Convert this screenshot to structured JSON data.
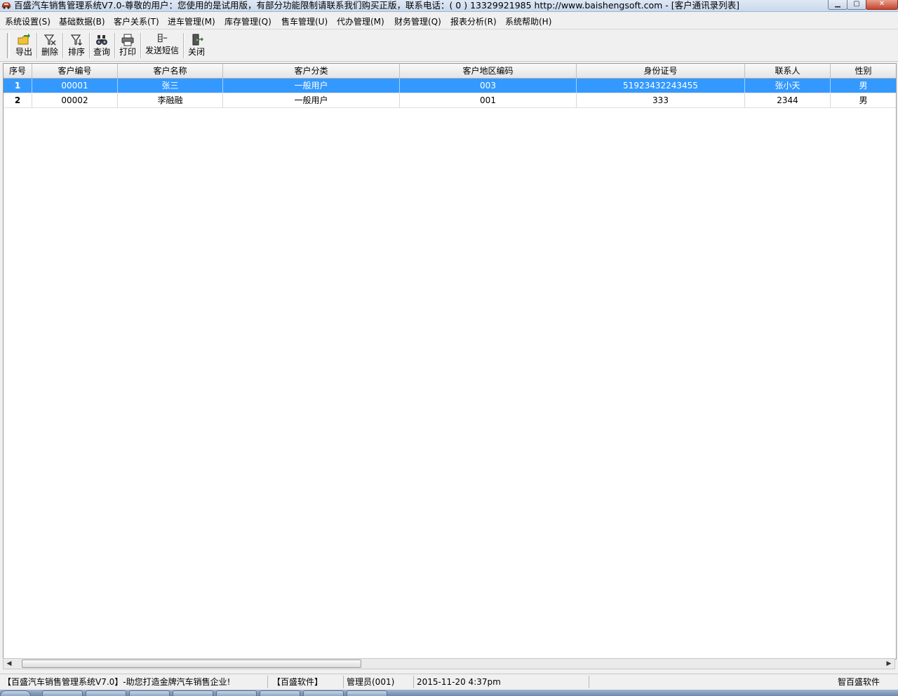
{
  "window": {
    "title": "百盛汽车销售管理系统V7.0-尊敬的用户：您使用的是试用版，有部分功能限制请联系我们购买正版，联系电话：( 0 ) 13329921985  http://www.baishengsoft.com - [客户通讯录列表]",
    "min_glyph": "▁",
    "max_glyph": "▢",
    "close_glyph": "✕"
  },
  "menu": [
    "系统设置(S)",
    "基础数据(B)",
    "客户关系(T)",
    "进车管理(M)",
    "库存管理(Q)",
    "售车管理(U)",
    "代办管理(M)",
    "财务管理(Q)",
    "报表分析(R)",
    "系统帮助(H)"
  ],
  "toolbar": {
    "export": "导出",
    "delete": "删除",
    "sort": "排序",
    "query": "查询",
    "print": "打印",
    "sms": "发送短信",
    "close": "关闭"
  },
  "grid": {
    "columns": [
      "序号",
      "客户编号",
      "客户名称",
      "客户分类",
      "客户地区编码",
      "身份证号",
      "联系人",
      "性别"
    ],
    "rows": [
      [
        "1",
        "00001",
        "张三",
        "一般用户",
        "003",
        "51923432243455",
        "张小天",
        "男"
      ],
      [
        "2",
        "00002",
        "李融融",
        "一般用户",
        "001",
        "333",
        "2344",
        "男"
      ]
    ],
    "selected_color": "#3399ff"
  },
  "scrollbar": {
    "left": "◀",
    "right": "▶"
  },
  "status": {
    "app": "【百盛汽车销售管理系统V7.0】-助您打造金牌汽车销售企业!",
    "company": "【百盛软件】",
    "user": "管理员(001)",
    "datetime": "2015-11-20 4:37pm",
    "brand": "智百盛软件"
  }
}
